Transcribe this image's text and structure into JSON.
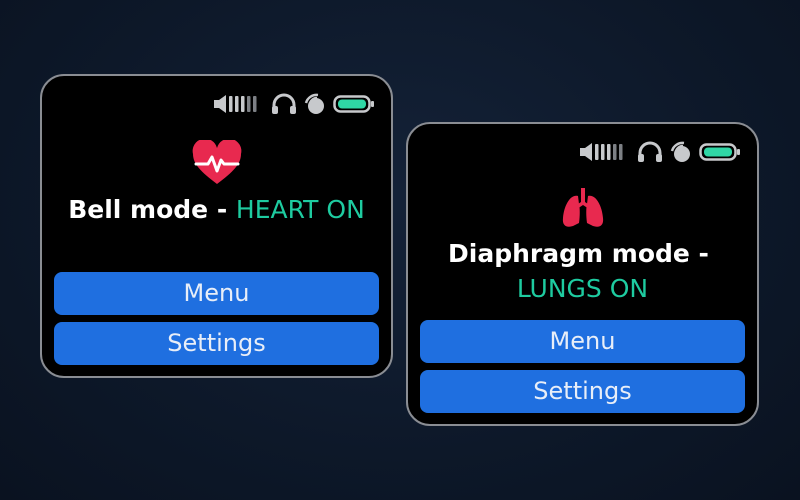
{
  "colors": {
    "accent_on": "#1ecba0",
    "button_bg": "#1f6fe0",
    "heart_red": "#e8294f",
    "battery_green": "#2fd6a5"
  },
  "screens": [
    {
      "status_icons": [
        "volume-icon",
        "headphones-icon",
        "signal-icon",
        "battery-icon"
      ],
      "mode_icon": "heart-pulse-icon",
      "mode_label": "Bell mode - ",
      "mode_state": "HEART ON",
      "menu_label": "Menu",
      "settings_label": "Settings"
    },
    {
      "status_icons": [
        "volume-icon",
        "headphones-icon",
        "signal-icon",
        "battery-icon"
      ],
      "mode_icon": "lungs-icon",
      "mode_label": "Diaphragm mode -",
      "mode_state": "LUNGS ON",
      "menu_label": "Menu",
      "settings_label": "Settings"
    }
  ]
}
